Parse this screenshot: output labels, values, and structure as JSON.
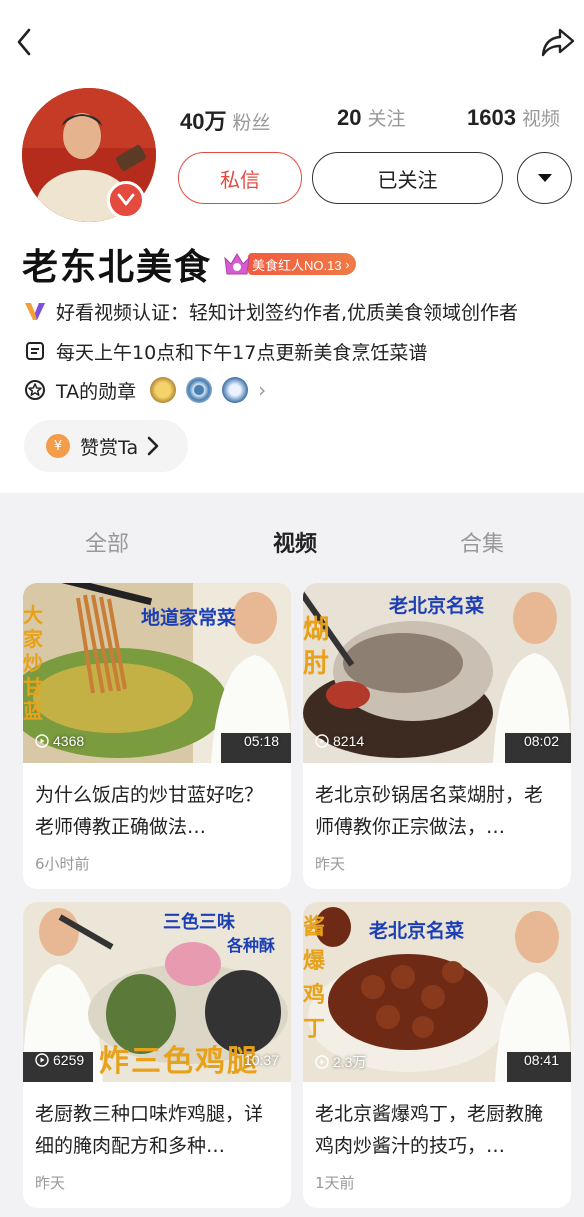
{
  "profile": {
    "name": "老东北美食",
    "rank_badge": "美食红人NO.13",
    "stats": [
      {
        "value": "40万",
        "label": "粉丝"
      },
      {
        "value": "20",
        "label": "关注"
      },
      {
        "value": "1603",
        "label": "视频"
      }
    ],
    "message_label": "私信",
    "follow_label": "已关注",
    "certification": "好看视频认证：轻知计划签约作者,优质美食领域创作者",
    "description": "每天上午10点和下午17点更新美食烹饪菜谱",
    "medals_label": "TA的勋章",
    "medal_more": "›",
    "reward_label": "赞赏Ta",
    "reward_coin": "¥"
  },
  "tabs": [
    {
      "label": "全部",
      "active": false
    },
    {
      "label": "视频",
      "active": true
    },
    {
      "label": "合集",
      "active": false
    }
  ],
  "videos": [
    {
      "title": "为什么饭店的炒甘蓝好吃？老师傅教正确做法…",
      "plays": "4368",
      "duration": "05:18",
      "time": "6小时前",
      "overlay": "地道家常菜",
      "side_text": "大家炒甘蓝"
    },
    {
      "title": "老北京砂锅居名菜煳肘，老师傅教你正宗做法，…",
      "plays": "8214",
      "duration": "08:02",
      "time": "昨天",
      "overlay": "老北京名菜",
      "side_text": "煳肘"
    },
    {
      "title": "老厨教三种口味炸鸡腿，详细的腌肉配方和多种…",
      "plays": "6259",
      "duration": "10:37",
      "time": "昨天",
      "overlay": "三色三味",
      "overlay2": "各种酥",
      "bottom_text": "炸三色鸡腿"
    },
    {
      "title": "老北京酱爆鸡丁，老厨教腌鸡肉炒酱汁的技巧，…",
      "plays": "2.3万",
      "duration": "08:41",
      "time": "1天前",
      "overlay": "老北京名菜",
      "side_text": "酱爆鸡丁"
    }
  ],
  "colors": {
    "accent": "#e24b40",
    "badge": "#f25b3e",
    "muted": "#999999"
  }
}
